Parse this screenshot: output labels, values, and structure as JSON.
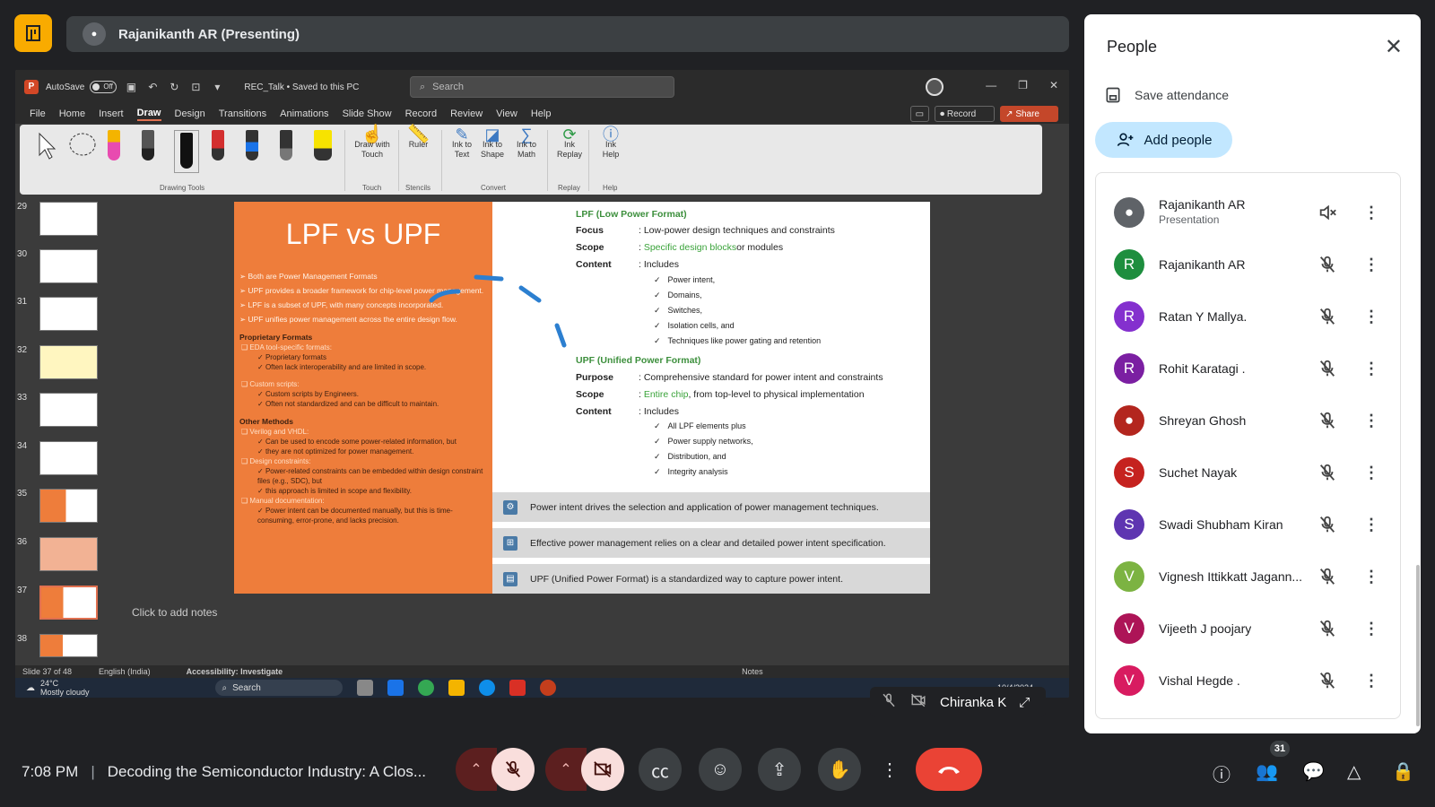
{
  "presenter": {
    "name": "Rajanikanth AR (Presenting)"
  },
  "ppt": {
    "autosave_label": "AutoSave",
    "autosave_state": "Off",
    "doc_title": "REC_Talk • Saved to this PC",
    "search_placeholder": "Search",
    "menu": [
      "File",
      "Home",
      "Insert",
      "Draw",
      "Design",
      "Transitions",
      "Animations",
      "Slide Show",
      "Record",
      "Review",
      "View",
      "Help"
    ],
    "active_menu": "Draw",
    "record_btn": "Record",
    "share_btn": "Share",
    "ribbon": {
      "draw_with_touch": "Draw with Touch",
      "ruler": "Ruler",
      "ink_to_text": "Ink to Text",
      "ink_to_shape": "Ink to Shape",
      "ink_to_math": "Ink to Math",
      "ink_replay": "Ink Replay",
      "ink_help": "Ink Help",
      "groups": {
        "drawing_tools": "Drawing Tools",
        "touch": "Touch",
        "stencils": "Stencils",
        "convert": "Convert",
        "replay": "Replay",
        "help": "Help"
      }
    },
    "slide_numbers": [
      "29",
      "30",
      "31",
      "32",
      "33",
      "34",
      "35",
      "36",
      "37",
      "38"
    ],
    "notes_placeholder": "Click to add notes",
    "status": {
      "slide": "Slide 37 of 48",
      "language": "English (India)",
      "accessibility": "Accessibility: Investigate",
      "notes": "Notes"
    },
    "taskbar": {
      "temp": "24°C",
      "weather": "Mostly cloudy",
      "search": "Search",
      "date": "10/4/2024"
    }
  },
  "slide": {
    "title": "LPF vs UPF",
    "left_bullets": [
      "Both are Power Management Formats",
      "UPF provides a broader framework for chip-level power management.",
      "LPF is a subset of UPF, with many concepts incorporated.",
      "UPF unifies power management across the entire design flow."
    ],
    "proprietary": {
      "head": "Proprietary Formats",
      "eda": "EDA tool-specific formats:",
      "eda_items": [
        "Proprietary formats",
        "Often lack interoperability and are limited in scope."
      ],
      "custom": "Custom scripts:",
      "custom_items": [
        "Custom scripts by Engineers.",
        "Often not standardized and can be difficult to maintain."
      ]
    },
    "other": {
      "head": "Other Methods",
      "verilog": "Verilog and VHDL:",
      "verilog_items": [
        "Can be used to encode some power-related information, but",
        "they are not optimized for power management."
      ],
      "design": "Design constraints:",
      "design_items": [
        "Power-related constraints can be embedded within design constraint files (e.g., SDC), but",
        "this approach is limited in scope and flexibility."
      ],
      "manual": "Manual documentation:",
      "manual_items": [
        "Power intent can be documented manually, but this is time-consuming, error-prone, and lacks precision."
      ]
    },
    "lpf": {
      "title": "LPF (Low Power Format)",
      "focus_k": "Focus",
      "focus_v": ": Low-power design techniques and constraints",
      "scope_k": "Scope",
      "scope_link": "Specific design blocks",
      "scope_rest": " or modules",
      "content_k": "Content",
      "content_v": ": Includes",
      "items": [
        "Power intent,",
        "Domains,",
        "Switches,",
        "Isolation cells, and",
        "Techniques like power gating and retention"
      ]
    },
    "upf": {
      "title": "UPF (Unified Power Format)",
      "purpose_k": "Purpose",
      "purpose_v": ": Comprehensive standard for power intent and constraints",
      "scope_k": "Scope",
      "scope_link": "Entire chip",
      "scope_rest": ", from top-level to physical implementation",
      "content_k": "Content",
      "content_v": ": Includes",
      "items": [
        "All LPF elements plus",
        "Power supply networks,",
        "Distribution, and",
        "Integrity analysis"
      ]
    },
    "callouts": [
      "Power intent drives the selection and application of power management techniques.",
      "Effective power management relies on a clear and detailed power intent specification.",
      "UPF (Unified Power Format) is a standardized way to capture power intent."
    ]
  },
  "floating_tile": {
    "name": "Chiranka K"
  },
  "people": {
    "title": "People",
    "save_attendance": "Save attendance",
    "add_people": "Add people",
    "participants": [
      {
        "name": "Rajanikanth AR",
        "sub": "Presentation",
        "initial": "",
        "color": "#5f6368"
      },
      {
        "name": "Rajanikanth AR",
        "sub": "",
        "initial": "R",
        "color": "#1e8e3e"
      },
      {
        "name": "Ratan Y Mallya.",
        "sub": "",
        "initial": "R",
        "color": "#8430ce"
      },
      {
        "name": "Rohit Karatagi .",
        "sub": "",
        "initial": "R",
        "color": "#7b1fa2"
      },
      {
        "name": "Shreyan Ghosh",
        "sub": "",
        "initial": "",
        "color": "#b3261e"
      },
      {
        "name": "Suchet Nayak",
        "sub": "",
        "initial": "S",
        "color": "#c5221f"
      },
      {
        "name": "Swadi Shubham Kiran",
        "sub": "",
        "initial": "S",
        "color": "#5e35b1"
      },
      {
        "name": "Vignesh Ittikkatt Jagann...",
        "sub": "",
        "initial": "V",
        "color": "#7cb342"
      },
      {
        "name": "Vijeeth J poojary",
        "sub": "",
        "initial": "V",
        "color": "#ad1457"
      },
      {
        "name": "Vishal Hegde .",
        "sub": "",
        "initial": "V",
        "color": "#d81b60"
      }
    ]
  },
  "bottom": {
    "time": "7:08 PM",
    "meeting_title": "Decoding the Semiconductor Industry: A Clos...",
    "participant_count": "31"
  }
}
